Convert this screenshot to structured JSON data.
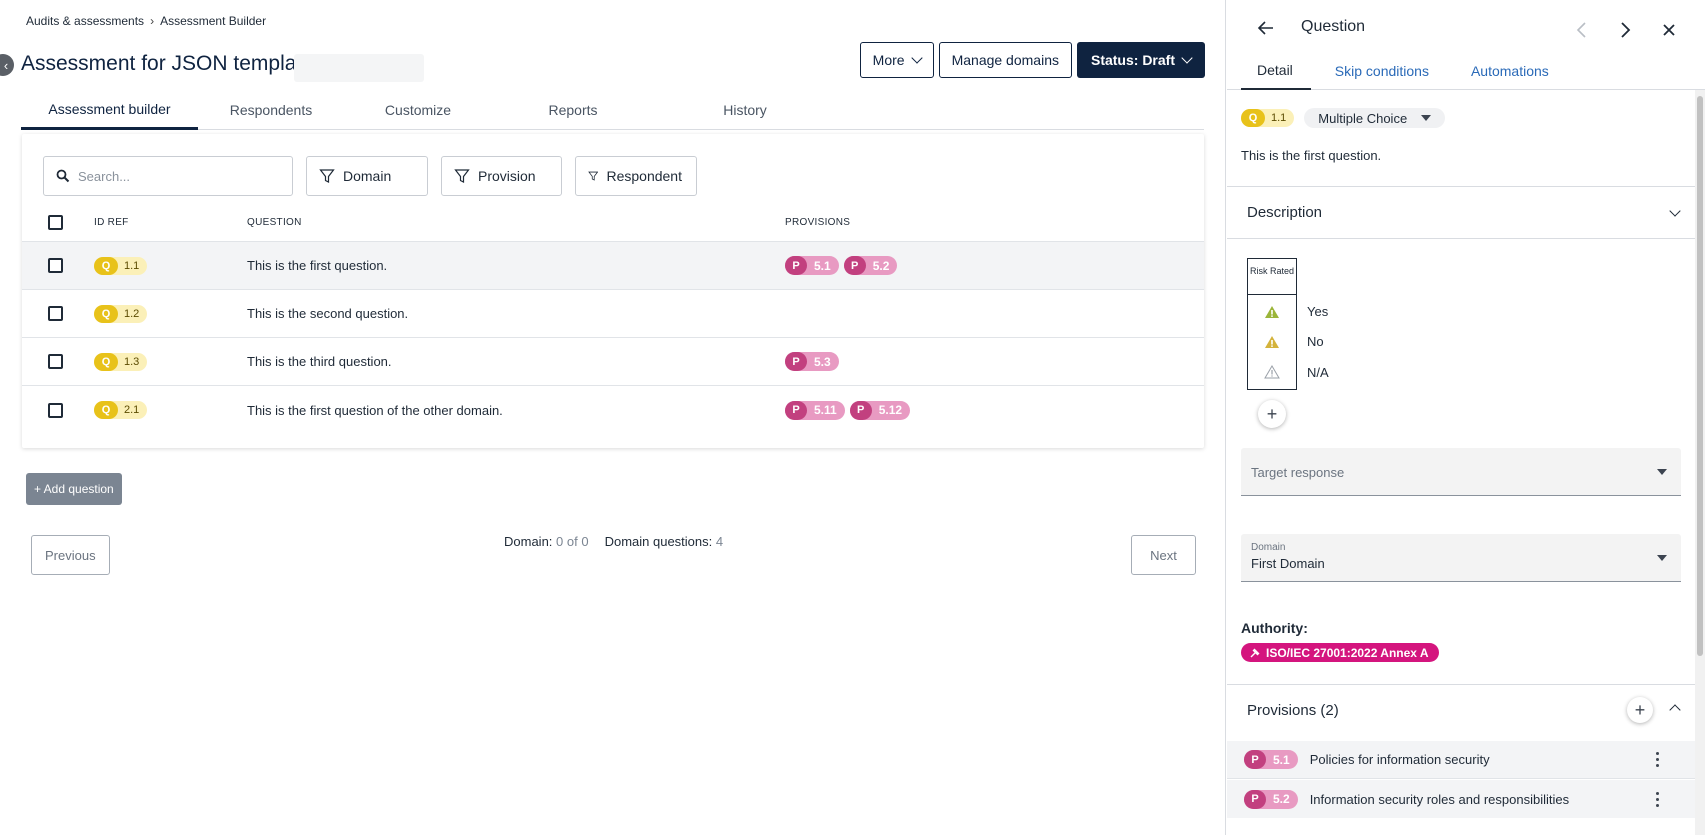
{
  "breadcrumb": {
    "root": "Audits & assessments",
    "current": "Assessment Builder"
  },
  "page": {
    "title": "Assessment for JSON template"
  },
  "actions": {
    "more": "More",
    "manage_domains": "Manage domains",
    "status": "Status: Draft"
  },
  "tabs": [
    {
      "label": "Assessment builder",
      "active": true
    },
    {
      "label": "Respondents"
    },
    {
      "label": "Customize"
    },
    {
      "label": "Reports"
    },
    {
      "label": "History"
    }
  ],
  "search": {
    "placeholder": "Search..."
  },
  "filters": [
    "Domain",
    "Provision",
    "Respondent"
  ],
  "table": {
    "headers": {
      "id": "ID REF",
      "question": "QUESTION",
      "provisions": "PROVISIONS"
    },
    "rows": [
      {
        "q": "Q",
        "id": "1.1",
        "question": "This is the first question.",
        "provisions": [
          "5.1",
          "5.2"
        ],
        "selected": true
      },
      {
        "q": "Q",
        "id": "1.2",
        "question": "This is the second question.",
        "provisions": []
      },
      {
        "q": "Q",
        "id": "1.3",
        "question": "This is the third question.",
        "provisions": [
          "5.3"
        ]
      },
      {
        "q": "Q",
        "id": "2.1",
        "question": "This is the first question of the other domain.",
        "provisions": [
          "5.11",
          "5.12"
        ]
      }
    ]
  },
  "add_question": "+ Add question",
  "pagination": {
    "previous": "Previous",
    "next": "Next",
    "domain_label": "Domain:",
    "domain_value": "0 of 0",
    "domain_questions_label": "Domain questions:",
    "domain_questions_value": "4"
  },
  "panel": {
    "title": "Question",
    "tabs": [
      "Detail",
      "Skip conditions",
      "Automations"
    ],
    "question_badge": {
      "q": "Q",
      "id": "1.1"
    },
    "type": "Multiple Choice",
    "question_text": "This is the first question.",
    "description_label": "Description",
    "risk_header": "Risk Rated",
    "answers": [
      "Yes",
      "No",
      "N/A"
    ],
    "target_response_label": "Target response",
    "domain_field": {
      "label": "Domain",
      "value": "First Domain"
    },
    "authority_label": "Authority:",
    "authority_value": "ISO/IEC 27001:2022 Annex A",
    "provisions_label": "Provisions (2)",
    "provisions": [
      {
        "p": "P",
        "id": "5.1",
        "name": "Policies for information security"
      },
      {
        "p": "P",
        "id": "5.2",
        "name": "Information security roles and responsibilities"
      }
    ]
  },
  "colors": {
    "primary": "#0f2340",
    "q_badge": "#e8c21a",
    "p_badge": "#c2407f",
    "authority": "#d4157e",
    "link": "#2a6ab8"
  }
}
